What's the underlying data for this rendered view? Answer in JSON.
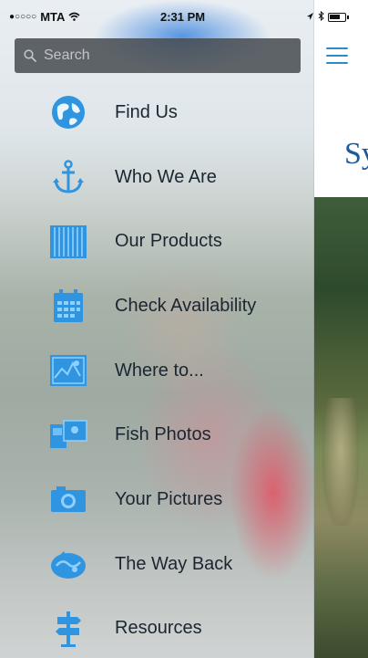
{
  "status_bar": {
    "carrier": "MTA",
    "signal": "●○○○○",
    "time": "2:31 PM"
  },
  "search": {
    "placeholder": "Search"
  },
  "menu": {
    "items": [
      {
        "label": "Find Us",
        "icon": "globe-icon"
      },
      {
        "label": "Who We Are",
        "icon": "anchor-icon"
      },
      {
        "label": "Our Products",
        "icon": "products-icon"
      },
      {
        "label": "Check Availability",
        "icon": "calendar-icon"
      },
      {
        "label": "Where to...",
        "icon": "map-icon"
      },
      {
        "label": "Fish Photos",
        "icon": "photos-icon"
      },
      {
        "label": "Your Pictures",
        "icon": "camera-icon"
      },
      {
        "label": "The Way Back",
        "icon": "way-back-icon"
      },
      {
        "label": "Resources",
        "icon": "signpost-icon"
      }
    ]
  },
  "main": {
    "title_fragment": "Sy"
  },
  "colors": {
    "accent": "#2a8cc9",
    "icon_blue": "#2f95e0",
    "title_blue": "#1e5a9a"
  }
}
